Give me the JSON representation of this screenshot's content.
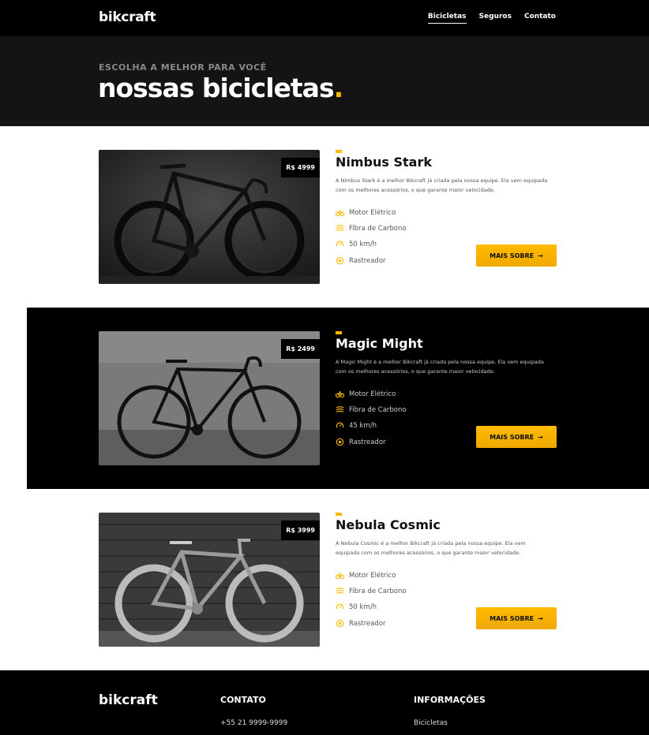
{
  "header": {
    "logo": "bikcraft",
    "nav": [
      "Bicicletas",
      "Seguros",
      "Contato"
    ]
  },
  "hero": {
    "subtitle": "ESCOLHA A MELHOR PARA VOCÊ",
    "title": "nossas bicicletas",
    "title_dot": "."
  },
  "bikes": [
    {
      "name": "Nimbus Stark",
      "price": "R$ 4999",
      "description": "A Nimbus Stark é a melhor Bikcraft já criada pela nossa equipe. Ela vem equipada com os melhores acessórios, o que garante maior velocidade.",
      "features": [
        "Motor Elétrico",
        "Fibra de Carbono",
        "50 km/h",
        "Rastreador"
      ],
      "button": "MAIS SOBRE"
    },
    {
      "name": "Magic Might",
      "price": "R$ 2499",
      "description": "A Magic Might é a melhor Bikcraft já criada pela nossa equipe. Ela vem equipada com os melhores acessórios, o que garante maior velocidade.",
      "features": [
        "Motor Elétrico",
        "Fibra de Carbono",
        "45 km/h",
        "Rastreador"
      ],
      "button": "MAIS SOBRE"
    },
    {
      "name": "Nebula Cosmic",
      "price": "R$ 3999",
      "description": "A Nebula Cosmic é a melhor Bikcraft já criada pela nossa equipe. Ela vem equipada com os melhores acessórios, o que garante maior velocidade.",
      "features": [
        "Motor Elétrico",
        "Fibra de Carbono",
        "50 km/h",
        "Rastreador"
      ],
      "button": "MAIS SOBRE"
    }
  ],
  "footer": {
    "logo": "bikcraft",
    "contato_title": "CONTATO",
    "phone": "+55 21 9999-9999",
    "info_title": "INFORMAÇÕES",
    "info_link": "Bicicletas"
  },
  "colors": {
    "accent": "#ffbb00",
    "dark": "#000000",
    "hero": "#141414"
  },
  "icons": [
    "bike-icon",
    "carbon-icon",
    "speed-icon",
    "tracker-icon",
    "arrow-right-icon"
  ]
}
